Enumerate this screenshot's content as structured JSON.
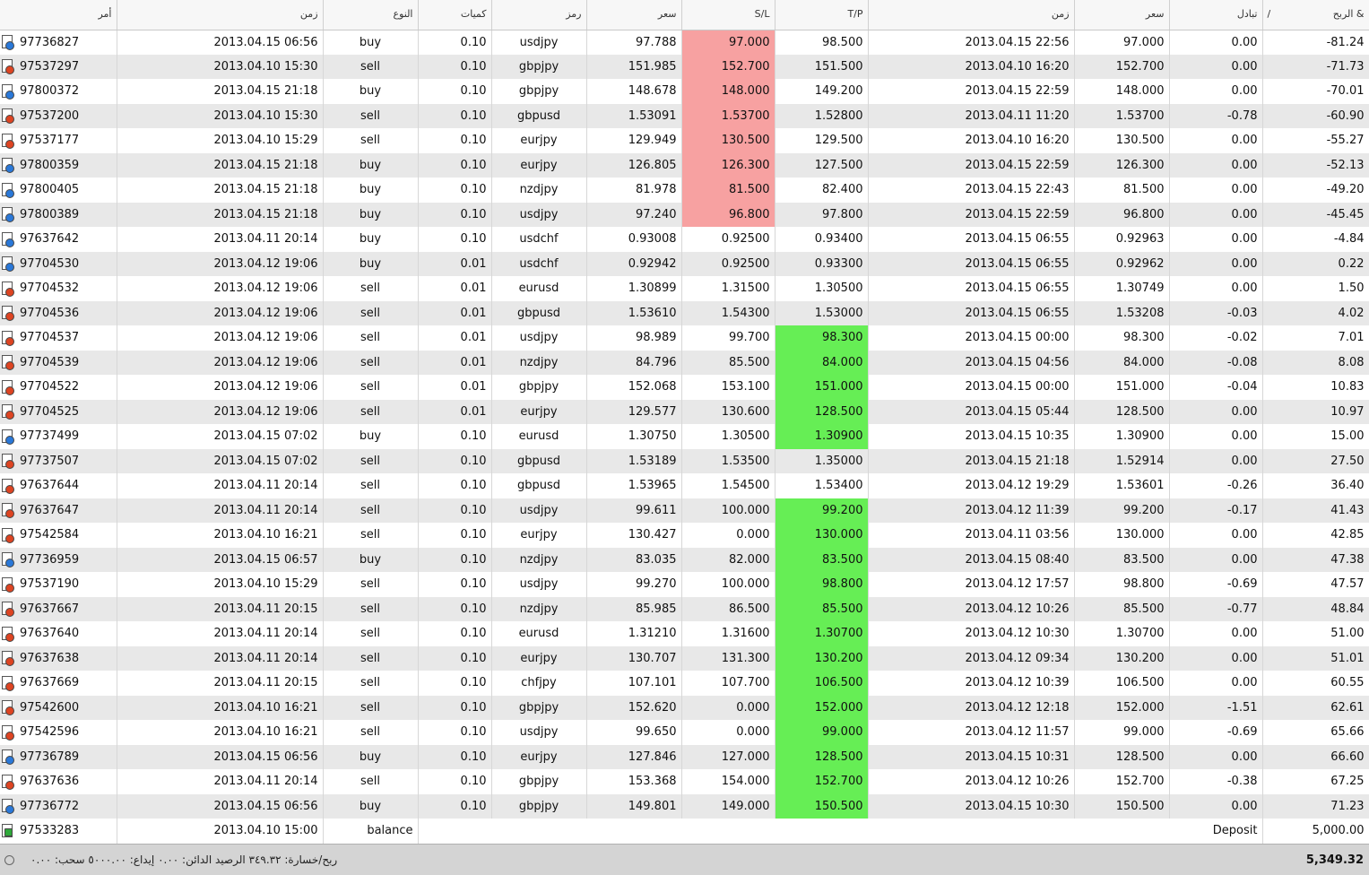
{
  "headers": {
    "order": "أمر",
    "open_time": "زمن",
    "type": "النوع",
    "size": "كميات",
    "symbol": "رمز",
    "open_price": "سعر",
    "sl": "S/L",
    "tp": "T/P",
    "close_time": "زمن",
    "close_price": "سعر",
    "swap": "تبادل",
    "profit": "الربح &",
    "sort_indicator": "/"
  },
  "rows": [
    {
      "order": "97736827",
      "open_time": "2013.04.15 06:56",
      "type": "buy",
      "size": "0.10",
      "symbol": "usdjpy",
      "open_price": "97.788",
      "sl": "97.000",
      "tp": "98.500",
      "close_time": "2013.04.15 22:56",
      "close_price": "97.000",
      "swap": "0.00",
      "profit": "-81.24",
      "hit": "sl"
    },
    {
      "order": "97537297",
      "open_time": "2013.04.10 15:30",
      "type": "sell",
      "size": "0.10",
      "symbol": "gbpjpy",
      "open_price": "151.985",
      "sl": "152.700",
      "tp": "151.500",
      "close_time": "2013.04.10 16:20",
      "close_price": "152.700",
      "swap": "0.00",
      "profit": "-71.73",
      "hit": "sl"
    },
    {
      "order": "97800372",
      "open_time": "2013.04.15 21:18",
      "type": "buy",
      "size": "0.10",
      "symbol": "gbpjpy",
      "open_price": "148.678",
      "sl": "148.000",
      "tp": "149.200",
      "close_time": "2013.04.15 22:59",
      "close_price": "148.000",
      "swap": "0.00",
      "profit": "-70.01",
      "hit": "sl"
    },
    {
      "order": "97537200",
      "open_time": "2013.04.10 15:30",
      "type": "sell",
      "size": "0.10",
      "symbol": "gbpusd",
      "open_price": "1.53091",
      "sl": "1.53700",
      "tp": "1.52800",
      "close_time": "2013.04.11 11:20",
      "close_price": "1.53700",
      "swap": "-0.78",
      "profit": "-60.90",
      "hit": "sl"
    },
    {
      "order": "97537177",
      "open_time": "2013.04.10 15:29",
      "type": "sell",
      "size": "0.10",
      "symbol": "eurjpy",
      "open_price": "129.949",
      "sl": "130.500",
      "tp": "129.500",
      "close_time": "2013.04.10 16:20",
      "close_price": "130.500",
      "swap": "0.00",
      "profit": "-55.27",
      "hit": "sl"
    },
    {
      "order": "97800359",
      "open_time": "2013.04.15 21:18",
      "type": "buy",
      "size": "0.10",
      "symbol": "eurjpy",
      "open_price": "126.805",
      "sl": "126.300",
      "tp": "127.500",
      "close_time": "2013.04.15 22:59",
      "close_price": "126.300",
      "swap": "0.00",
      "profit": "-52.13",
      "hit": "sl"
    },
    {
      "order": "97800405",
      "open_time": "2013.04.15 21:18",
      "type": "buy",
      "size": "0.10",
      "symbol": "nzdjpy",
      "open_price": "81.978",
      "sl": "81.500",
      "tp": "82.400",
      "close_time": "2013.04.15 22:43",
      "close_price": "81.500",
      "swap": "0.00",
      "profit": "-49.20",
      "hit": "sl"
    },
    {
      "order": "97800389",
      "open_time": "2013.04.15 21:18",
      "type": "buy",
      "size": "0.10",
      "symbol": "usdjpy",
      "open_price": "97.240",
      "sl": "96.800",
      "tp": "97.800",
      "close_time": "2013.04.15 22:59",
      "close_price": "96.800",
      "swap": "0.00",
      "profit": "-45.45",
      "hit": "sl"
    },
    {
      "order": "97637642",
      "open_time": "2013.04.11 20:14",
      "type": "buy",
      "size": "0.10",
      "symbol": "usdchf",
      "open_price": "0.93008",
      "sl": "0.92500",
      "tp": "0.93400",
      "close_time": "2013.04.15 06:55",
      "close_price": "0.92963",
      "swap": "0.00",
      "profit": "-4.84",
      "hit": ""
    },
    {
      "order": "97704530",
      "open_time": "2013.04.12 19:06",
      "type": "buy",
      "size": "0.01",
      "symbol": "usdchf",
      "open_price": "0.92942",
      "sl": "0.92500",
      "tp": "0.93300",
      "close_time": "2013.04.15 06:55",
      "close_price": "0.92962",
      "swap": "0.00",
      "profit": "0.22",
      "hit": ""
    },
    {
      "order": "97704532",
      "open_time": "2013.04.12 19:06",
      "type": "sell",
      "size": "0.01",
      "symbol": "eurusd",
      "open_price": "1.30899",
      "sl": "1.31500",
      "tp": "1.30500",
      "close_time": "2013.04.15 06:55",
      "close_price": "1.30749",
      "swap": "0.00",
      "profit": "1.50",
      "hit": ""
    },
    {
      "order": "97704536",
      "open_time": "2013.04.12 19:06",
      "type": "sell",
      "size": "0.01",
      "symbol": "gbpusd",
      "open_price": "1.53610",
      "sl": "1.54300",
      "tp": "1.53000",
      "close_time": "2013.04.15 06:55",
      "close_price": "1.53208",
      "swap": "-0.03",
      "profit": "4.02",
      "hit": ""
    },
    {
      "order": "97704537",
      "open_time": "2013.04.12 19:06",
      "type": "sell",
      "size": "0.01",
      "symbol": "usdjpy",
      "open_price": "98.989",
      "sl": "99.700",
      "tp": "98.300",
      "close_time": "2013.04.15 00:00",
      "close_price": "98.300",
      "swap": "-0.02",
      "profit": "7.01",
      "hit": "tp"
    },
    {
      "order": "97704539",
      "open_time": "2013.04.12 19:06",
      "type": "sell",
      "size": "0.01",
      "symbol": "nzdjpy",
      "open_price": "84.796",
      "sl": "85.500",
      "tp": "84.000",
      "close_time": "2013.04.15 04:56",
      "close_price": "84.000",
      "swap": "-0.08",
      "profit": "8.08",
      "hit": "tp"
    },
    {
      "order": "97704522",
      "open_time": "2013.04.12 19:06",
      "type": "sell",
      "size": "0.01",
      "symbol": "gbpjpy",
      "open_price": "152.068",
      "sl": "153.100",
      "tp": "151.000",
      "close_time": "2013.04.15 00:00",
      "close_price": "151.000",
      "swap": "-0.04",
      "profit": "10.83",
      "hit": "tp"
    },
    {
      "order": "97704525",
      "open_time": "2013.04.12 19:06",
      "type": "sell",
      "size": "0.01",
      "symbol": "eurjpy",
      "open_price": "129.577",
      "sl": "130.600",
      "tp": "128.500",
      "close_time": "2013.04.15 05:44",
      "close_price": "128.500",
      "swap": "0.00",
      "profit": "10.97",
      "hit": "tp"
    },
    {
      "order": "97737499",
      "open_time": "2013.04.15 07:02",
      "type": "buy",
      "size": "0.10",
      "symbol": "eurusd",
      "open_price": "1.30750",
      "sl": "1.30500",
      "tp": "1.30900",
      "close_time": "2013.04.15 10:35",
      "close_price": "1.30900",
      "swap": "0.00",
      "profit": "15.00",
      "hit": "tp"
    },
    {
      "order": "97737507",
      "open_time": "2013.04.15 07:02",
      "type": "sell",
      "size": "0.10",
      "symbol": "gbpusd",
      "open_price": "1.53189",
      "sl": "1.53500",
      "tp": "1.35000",
      "close_time": "2013.04.15 21:18",
      "close_price": "1.52914",
      "swap": "0.00",
      "profit": "27.50",
      "hit": ""
    },
    {
      "order": "97637644",
      "open_time": "2013.04.11 20:14",
      "type": "sell",
      "size": "0.10",
      "symbol": "gbpusd",
      "open_price": "1.53965",
      "sl": "1.54500",
      "tp": "1.53400",
      "close_time": "2013.04.12 19:29",
      "close_price": "1.53601",
      "swap": "-0.26",
      "profit": "36.40",
      "hit": ""
    },
    {
      "order": "97637647",
      "open_time": "2013.04.11 20:14",
      "type": "sell",
      "size": "0.10",
      "symbol": "usdjpy",
      "open_price": "99.611",
      "sl": "100.000",
      "tp": "99.200",
      "close_time": "2013.04.12 11:39",
      "close_price": "99.200",
      "swap": "-0.17",
      "profit": "41.43",
      "hit": "tp"
    },
    {
      "order": "97542584",
      "open_time": "2013.04.10 16:21",
      "type": "sell",
      "size": "0.10",
      "symbol": "eurjpy",
      "open_price": "130.427",
      "sl": "0.000",
      "tp": "130.000",
      "close_time": "2013.04.11 03:56",
      "close_price": "130.000",
      "swap": "0.00",
      "profit": "42.85",
      "hit": "tp"
    },
    {
      "order": "97736959",
      "open_time": "2013.04.15 06:57",
      "type": "buy",
      "size": "0.10",
      "symbol": "nzdjpy",
      "open_price": "83.035",
      "sl": "82.000",
      "tp": "83.500",
      "close_time": "2013.04.15 08:40",
      "close_price": "83.500",
      "swap": "0.00",
      "profit": "47.38",
      "hit": "tp"
    },
    {
      "order": "97537190",
      "open_time": "2013.04.10 15:29",
      "type": "sell",
      "size": "0.10",
      "symbol": "usdjpy",
      "open_price": "99.270",
      "sl": "100.000",
      "tp": "98.800",
      "close_time": "2013.04.12 17:57",
      "close_price": "98.800",
      "swap": "-0.69",
      "profit": "47.57",
      "hit": "tp"
    },
    {
      "order": "97637667",
      "open_time": "2013.04.11 20:15",
      "type": "sell",
      "size": "0.10",
      "symbol": "nzdjpy",
      "open_price": "85.985",
      "sl": "86.500",
      "tp": "85.500",
      "close_time": "2013.04.12 10:26",
      "close_price": "85.500",
      "swap": "-0.77",
      "profit": "48.84",
      "hit": "tp"
    },
    {
      "order": "97637640",
      "open_time": "2013.04.11 20:14",
      "type": "sell",
      "size": "0.10",
      "symbol": "eurusd",
      "open_price": "1.31210",
      "sl": "1.31600",
      "tp": "1.30700",
      "close_time": "2013.04.12 10:30",
      "close_price": "1.30700",
      "swap": "0.00",
      "profit": "51.00",
      "hit": "tp"
    },
    {
      "order": "97637638",
      "open_time": "2013.04.11 20:14",
      "type": "sell",
      "size": "0.10",
      "symbol": "eurjpy",
      "open_price": "130.707",
      "sl": "131.300",
      "tp": "130.200",
      "close_time": "2013.04.12 09:34",
      "close_price": "130.200",
      "swap": "0.00",
      "profit": "51.01",
      "hit": "tp"
    },
    {
      "order": "97637669",
      "open_time": "2013.04.11 20:15",
      "type": "sell",
      "size": "0.10",
      "symbol": "chfjpy",
      "open_price": "107.101",
      "sl": "107.700",
      "tp": "106.500",
      "close_time": "2013.04.12 10:39",
      "close_price": "106.500",
      "swap": "0.00",
      "profit": "60.55",
      "hit": "tp"
    },
    {
      "order": "97542600",
      "open_time": "2013.04.10 16:21",
      "type": "sell",
      "size": "0.10",
      "symbol": "gbpjpy",
      "open_price": "152.620",
      "sl": "0.000",
      "tp": "152.000",
      "close_time": "2013.04.12 12:18",
      "close_price": "152.000",
      "swap": "-1.51",
      "profit": "62.61",
      "hit": "tp"
    },
    {
      "order": "97542596",
      "open_time": "2013.04.10 16:21",
      "type": "sell",
      "size": "0.10",
      "symbol": "usdjpy",
      "open_price": "99.650",
      "sl": "0.000",
      "tp": "99.000",
      "close_time": "2013.04.12 11:57",
      "close_price": "99.000",
      "swap": "-0.69",
      "profit": "65.66",
      "hit": "tp"
    },
    {
      "order": "97736789",
      "open_time": "2013.04.15 06:56",
      "type": "buy",
      "size": "0.10",
      "symbol": "eurjpy",
      "open_price": "127.846",
      "sl": "127.000",
      "tp": "128.500",
      "close_time": "2013.04.15 10:31",
      "close_price": "128.500",
      "swap": "0.00",
      "profit": "66.60",
      "hit": "tp"
    },
    {
      "order": "97637636",
      "open_time": "2013.04.11 20:14",
      "type": "sell",
      "size": "0.10",
      "symbol": "gbpjpy",
      "open_price": "153.368",
      "sl": "154.000",
      "tp": "152.700",
      "close_time": "2013.04.12 10:26",
      "close_price": "152.700",
      "swap": "-0.38",
      "profit": "67.25",
      "hit": "tp"
    },
    {
      "order": "97736772",
      "open_time": "2013.04.15 06:56",
      "type": "buy",
      "size": "0.10",
      "symbol": "gbpjpy",
      "open_price": "149.801",
      "sl": "149.000",
      "tp": "150.500",
      "close_time": "2013.04.15 10:30",
      "close_price": "150.500",
      "swap": "0.00",
      "profit": "71.23",
      "hit": "tp"
    }
  ],
  "balance_row": {
    "order": "97533283",
    "open_time": "2013.04.10 15:00",
    "type": "balance",
    "comment": "Deposit",
    "profit": "5,000.00"
  },
  "footer": {
    "summary": "ربح/خسارة: ٣٤٩.٣٢  الرصيد الدائن: ٠.٠٠  إيداع: ٥٠٠٠.٠٠  سحب: ٠.٠٠",
    "total": "5,349.32"
  },
  "colors": {
    "sl_hit": "#f7a1a1",
    "tp_hit": "#66ee55",
    "buy_icon": "#2a78d8",
    "sell_icon": "#dd4422",
    "balance_icon": "#2fa83a"
  }
}
